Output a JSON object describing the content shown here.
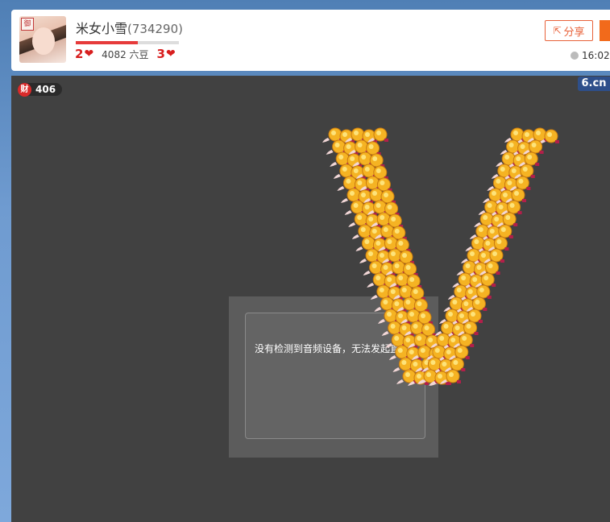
{
  "header": {
    "avatar_badge": "御",
    "name": "米女小雪",
    "room_id": "(734290)",
    "level_left": "2",
    "beans": "4082 六豆",
    "level_right": "3",
    "share_label": "分享",
    "time": "16:02",
    "progress_fraction": 0.6
  },
  "stage": {
    "wealth_icon": "财",
    "wealth_value": "406",
    "logo": "6.cn",
    "dialog_message": "没有检测到音频设备，无法发起直播"
  },
  "colors": {
    "accent": "#e8623a",
    "orange": "#f26a1b",
    "level_red": "#d81e1e",
    "stage_bg": "#414141"
  }
}
